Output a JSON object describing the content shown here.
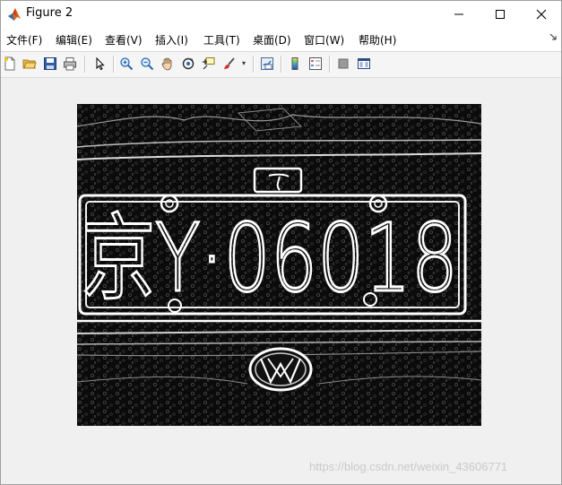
{
  "window": {
    "title": "Figure 2"
  },
  "menu": {
    "items": [
      {
        "label": "文件(F)"
      },
      {
        "label": "编辑(E)"
      },
      {
        "label": "查看(V)"
      },
      {
        "label": "插入(I)"
      },
      {
        "label": "工具(T)"
      },
      {
        "label": "桌面(D)"
      },
      {
        "label": "窗口(W)"
      },
      {
        "label": "帮助(H)"
      }
    ],
    "overflow_icon": "dock-arrow-icon"
  },
  "toolbar": {
    "icons": [
      "new-figure-icon",
      "open-file-icon",
      "save-icon",
      "print-icon",
      "pointer-icon",
      "zoom-in-icon",
      "zoom-out-icon",
      "pan-hand-icon",
      "rotate-3d-icon",
      "data-cursor-icon",
      "brush-icon",
      "link-plot-icon",
      "colorbar-icon",
      "legend-icon",
      "hide-plot-tools-icon",
      "show-plot-tools-icon"
    ]
  },
  "figure": {
    "plate_text": "京Y·06018",
    "emblem": "VW"
  },
  "watermark": "https://blog.csdn.net/weixin_43606771",
  "colors": {
    "titlebar": "#ffffff",
    "menubar": "#ffffff",
    "figure_bg": "#f0f0f0",
    "image_bg": "#0b0b0b"
  }
}
